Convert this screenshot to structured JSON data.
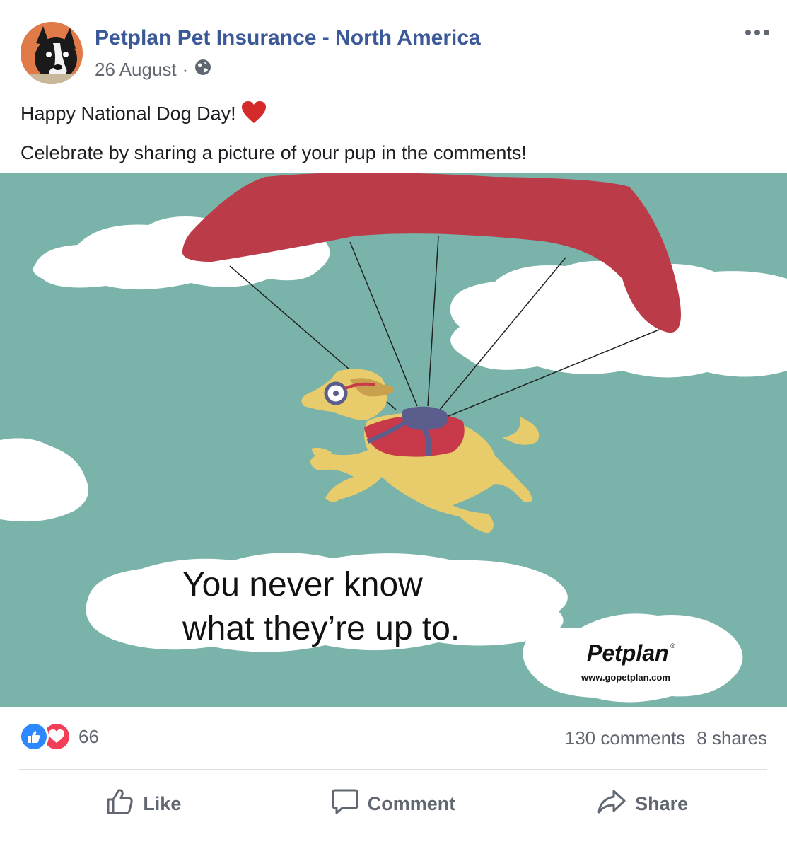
{
  "post": {
    "page_name": "Petplan Pet Insurance - North America",
    "date": "26 August",
    "separator": "·",
    "text_line1": "Happy National Dog Day!",
    "text_line2": "Celebrate by sharing a picture of your pup in the comments!"
  },
  "image": {
    "headline_line1": "You never know",
    "headline_line2": "what they’re up to.",
    "logo_text": "Petplan",
    "logo_mark": "®",
    "website": "www.gopetplan.com",
    "colors": {
      "sky": "#79b3a9",
      "glider": "#bb3c48",
      "dog": "#e8cc6b",
      "harness": "#5b5e8c",
      "vest": "#c8394a"
    }
  },
  "stats": {
    "reaction_count": "66",
    "comments": "130 comments",
    "shares": "8 shares"
  },
  "actions": {
    "like": "Like",
    "comment": "Comment",
    "share": "Share"
  },
  "icons": [
    "globe-icon",
    "more-options-icon",
    "heart-emoji-icon",
    "like-reaction-icon",
    "love-reaction-icon",
    "thumbs-up-icon",
    "comment-icon",
    "share-icon"
  ]
}
